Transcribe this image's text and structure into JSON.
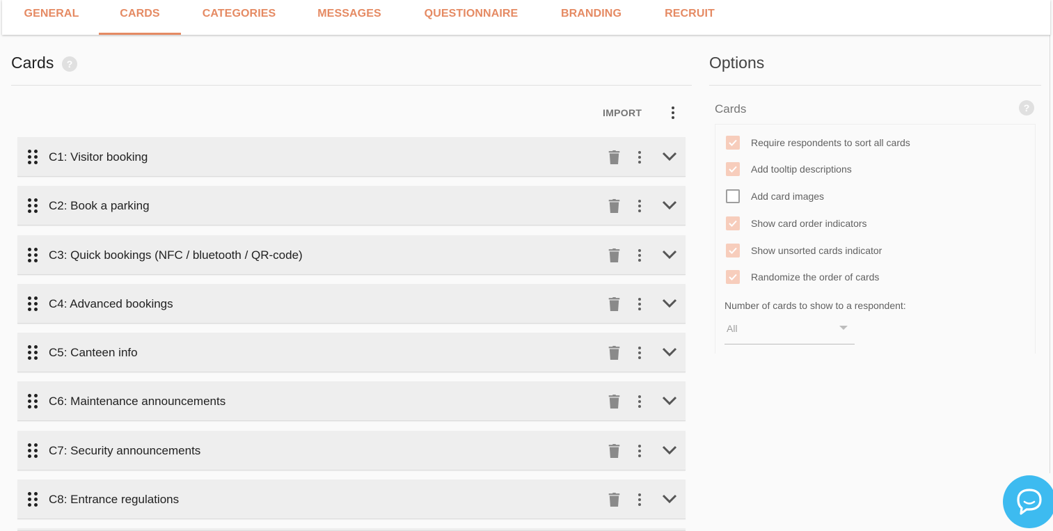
{
  "tabs": [
    {
      "label": "GENERAL"
    },
    {
      "label": "CARDS"
    },
    {
      "label": "CATEGORIES"
    },
    {
      "label": "MESSAGES"
    },
    {
      "label": "QUESTIONNAIRE"
    },
    {
      "label": "BRANDING"
    },
    {
      "label": "RECRUIT"
    }
  ],
  "active_tab": "CARDS",
  "colors": {
    "accent": "#e58a63",
    "checkbox_checked": "#f7cdbc",
    "row_background": "#eeeeee",
    "chat_bubble": "#3dbbf0"
  },
  "cards_panel": {
    "title": "Cards",
    "help_icon": "?",
    "import_label": "IMPORT",
    "cards": [
      {
        "label": "C1: Visitor booking"
      },
      {
        "label": "C2: Book a parking"
      },
      {
        "label": "C3: Quick bookings (NFC / bluetooth / QR-code)"
      },
      {
        "label": "C4: Advanced bookings"
      },
      {
        "label": "C5: Canteen info"
      },
      {
        "label": "C6: Maintenance announcements"
      },
      {
        "label": "C7: Security announcements"
      },
      {
        "label": "C8: Entrance regulations"
      }
    ]
  },
  "options_panel": {
    "title": "Options",
    "section_title": "Cards",
    "help_icon": "?",
    "options": [
      {
        "label": "Require respondents to sort all cards",
        "checked": true
      },
      {
        "label": "Add tooltip descriptions",
        "checked": true
      },
      {
        "label": "Add card images",
        "checked": false
      },
      {
        "label": "Show card order indicators",
        "checked": true
      },
      {
        "label": "Show unsorted cards indicator",
        "checked": true
      },
      {
        "label": "Randomize the order of cards",
        "checked": true
      }
    ],
    "num_cards_label": "Number of cards to show to a respondent:",
    "num_cards_value": "All"
  },
  "icons": {
    "drag": "drag-handle-icon",
    "trash": "trash-icon",
    "more": "more-vert-icon",
    "expand": "chevron-down-icon",
    "chat": "chat-icon"
  }
}
